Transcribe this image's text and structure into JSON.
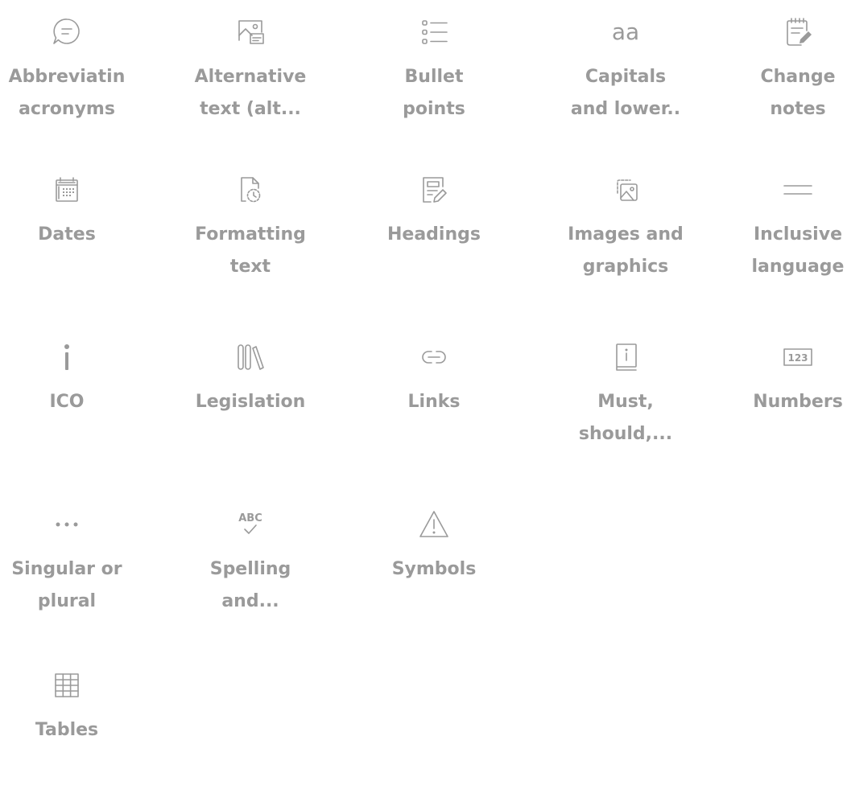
{
  "tiles": [
    {
      "label": "Abbreviatin\nacronyms",
      "icon": "chat-bubble-icon"
    },
    {
      "label": "Alternative\ntext (alt...",
      "icon": "image-caption-icon"
    },
    {
      "label": "Bullet\npoints",
      "icon": "bullet-list-icon"
    },
    {
      "label": "Capitals\nand lower..",
      "icon": "text-case-icon",
      "glyph": "aa"
    },
    {
      "label": "Change\nnotes",
      "icon": "notepad-edit-icon"
    },
    {
      "label": "Dates",
      "icon": "calendar-icon"
    },
    {
      "label": "Formatting\ntext",
      "icon": "document-clock-icon"
    },
    {
      "label": "Headings",
      "icon": "document-edit-icon"
    },
    {
      "label": "Images and\ngraphics",
      "icon": "images-icon"
    },
    {
      "label": "Inclusive\nlanguage",
      "icon": "lines-icon"
    },
    {
      "label": "ICO",
      "icon": "info-icon"
    },
    {
      "label": "Legislation",
      "icon": "library-books-icon"
    },
    {
      "label": "Links",
      "icon": "link-icon"
    },
    {
      "label": "Must,\nshould,...",
      "icon": "book-info-icon"
    },
    {
      "label": "Numbers",
      "icon": "number-symbol-icon",
      "glyph": "123"
    },
    {
      "label": "Singular or\nplural",
      "icon": "more-dots-icon"
    },
    {
      "label": "Spelling\nand...",
      "icon": "spell-check-icon",
      "glyph": "ABC"
    },
    {
      "label": "Symbols",
      "icon": "warning-icon"
    },
    {
      "label": "Tables",
      "icon": "table-icon"
    }
  ]
}
